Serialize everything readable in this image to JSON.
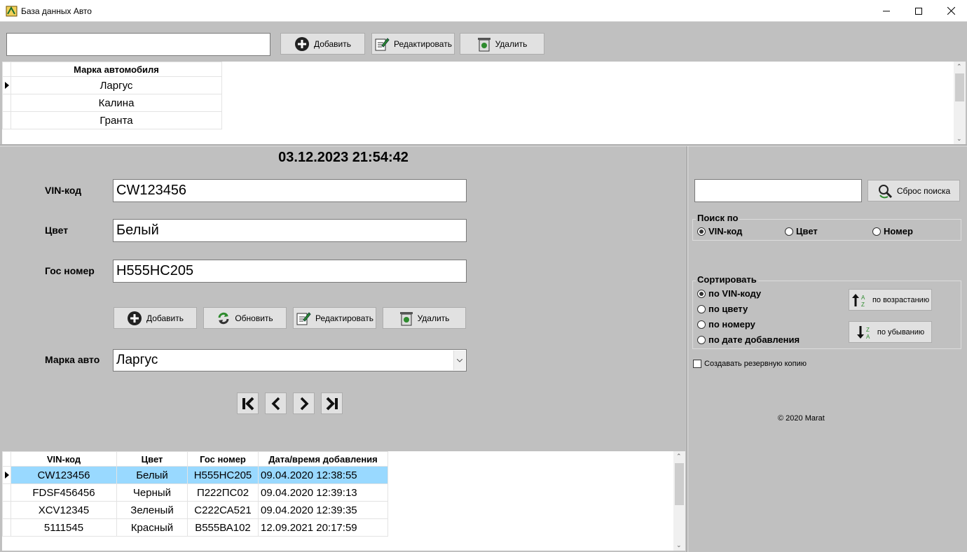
{
  "window": {
    "title": "База данных Авто",
    "minimize": "—",
    "maximize": "☐",
    "close": "✕"
  },
  "brand_toolbar": {
    "search_value": "",
    "add_label": "Добавить",
    "edit_label": "Редактировать",
    "delete_label": "Удалить"
  },
  "brand_grid": {
    "header": "Марка автомобиля",
    "rows": [
      "Ларгус",
      "Калина",
      "Гранта"
    ],
    "selected_index": 0
  },
  "datetime": "03.12.2023 21:54:42",
  "form": {
    "vin_label": "VIN-код",
    "vin_value": "CW123456",
    "color_label": "Цвет",
    "color_value": "Белый",
    "plate_label": "Гос номер",
    "plate_value": "Н555НС205",
    "brand_label": "Марка авто",
    "brand_value": "Ларгус",
    "add_label": "Добавить",
    "refresh_label": "Обновить",
    "edit_label": "Редактировать",
    "delete_label": "Удалить"
  },
  "records": {
    "columns": [
      "VIN-код",
      "Цвет",
      "Гос номер",
      "Дата/время добавления"
    ],
    "rows": [
      [
        "CW123456",
        "Белый",
        "Н555НС205",
        "09.04.2020 12:38:55"
      ],
      [
        "FDSF456456",
        "Черный",
        "П222ПС02",
        "09.04.2020 12:39:13"
      ],
      [
        "XCV12345",
        "Зеленый",
        "С222СА521",
        "09.04.2020 12:39:35"
      ],
      [
        "5111545",
        "Красный",
        "В555ВА102",
        "12.09.2021 20:17:59"
      ]
    ],
    "selected_index": 0
  },
  "search": {
    "value": "",
    "reset_label": "Сброс поиска",
    "group_title": "Поиск по",
    "options": [
      "VIN-код",
      "Цвет",
      "Номер"
    ],
    "selected": "VIN-код"
  },
  "sort": {
    "group_title": "Сортировать",
    "options": [
      "по VIN-коду",
      "по цвету",
      "по номеру",
      "по дате добавления"
    ],
    "selected": "по VIN-коду",
    "asc_label": "по возрастанию",
    "desc_label": "по убыванию"
  },
  "backup": {
    "label": "Создавать резервную копию",
    "checked": false
  },
  "copyright": "©  2020 Marat",
  "colors": {
    "selection": "#99d9ff",
    "background": "#c0c0c0"
  }
}
